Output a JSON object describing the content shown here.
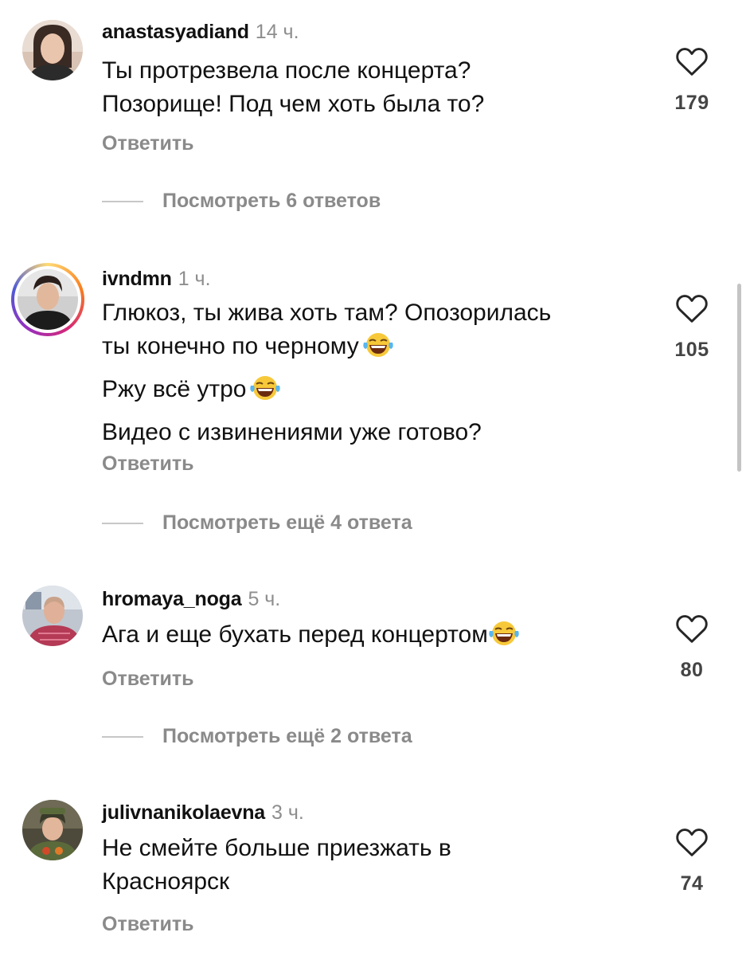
{
  "comments": [
    {
      "username": "anastasyadiand",
      "time": "14 ч.",
      "lines": [
        "Ты протрезвела после концерта?",
        "Позорище! Под чем хоть была то?"
      ],
      "reply_label": "Ответить",
      "likes": "179",
      "view_replies": "Посмотреть 6 ответов"
    },
    {
      "username": "ivndmn",
      "time": "1 ч.",
      "lines": [
        "Глюкоз, ты жива хоть там? Опозорилась",
        "ты конечно по черному",
        "Ржу всё утро",
        "Видео с извинениями уже готово?"
      ],
      "reply_label": "Ответить",
      "likes": "105",
      "view_replies": "Посмотреть ещё 4 ответа"
    },
    {
      "username": "hromaya_noga",
      "time": "5 ч.",
      "lines": [
        "Ага и еще бухать перед концертом"
      ],
      "reply_label": "Ответить",
      "likes": "80",
      "view_replies": "Посмотреть ещё 2 ответа"
    },
    {
      "username": "julivnanikolaevna",
      "time": "3 ч.",
      "lines": [
        "Не смейте больше приезжать в",
        "Красноярск"
      ],
      "reply_label": "Ответить",
      "likes": "74"
    }
  ]
}
